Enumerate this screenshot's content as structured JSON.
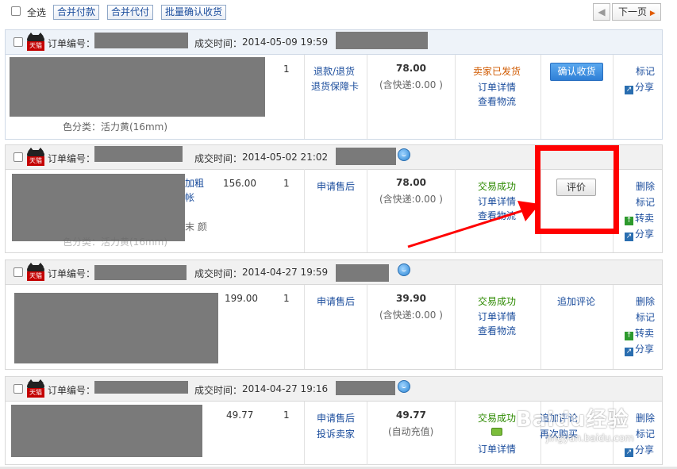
{
  "toolbar": {
    "select_all": "全选",
    "merge_pay": "合并付款",
    "merge_proxy_pay": "合并代付",
    "batch_confirm": "批量确认收货",
    "next_page": "下一页"
  },
  "labels": {
    "order_no": "订单编号：",
    "deal_time_prefix": "成交时间：",
    "tmall": "天猫"
  },
  "orders": [
    {
      "time": "2014-05-09 19:59",
      "qty": "1",
      "unit_price": "",
      "actions": [
        "退款/退货",
        "退货保障卡"
      ],
      "total": "78.00",
      "shipping": "(含快递:0.00 )",
      "status": "卖家已发货",
      "status_links": [
        "订单详情",
        "查看物流"
      ],
      "op_button": "确认收货",
      "op_link": "",
      "side": [
        "标记",
        "分享"
      ],
      "sku": "色分类：活力黄(16mm)"
    },
    {
      "time": "2014-05-02 21:02",
      "qty": "1",
      "unit_price": "156.00",
      "actions": [
        "申请售后"
      ],
      "total": "78.00",
      "shipping": "(含快递:0.00 )",
      "status": "交易成功",
      "status_links": [
        "订单详情",
        "查看物流"
      ],
      "op_button": "评价",
      "op_link": "",
      "side": [
        "删除",
        "标记",
        "转卖",
        "分享"
      ],
      "title_frags": [
        "加粗",
        "帐",
        "末 颜"
      ],
      "sku": "色分类：活力黄(16mm)"
    },
    {
      "time": "2014-04-27 19:59",
      "qty": "1",
      "unit_price": "199.00",
      "actions": [
        "申请售后"
      ],
      "total": "39.90",
      "shipping": "(含快递:0.00 )",
      "status": "交易成功",
      "status_links": [
        "订单详情",
        "查看物流"
      ],
      "op_button": "",
      "op_link": "追加评论",
      "side": [
        "删除",
        "标记",
        "转卖",
        "分享"
      ]
    },
    {
      "time": "2014-04-27 19:16",
      "qty": "1",
      "unit_price": "49.77",
      "actions": [
        "申请售后",
        "投诉卖家"
      ],
      "total": "49.77",
      "shipping": "(自动充值)",
      "status": "交易成功",
      "status_links": [
        "订单详情"
      ],
      "op_button": "",
      "op_link": "追加评论",
      "op_link2": "再次购买",
      "side": [
        "删除",
        "标记",
        "分享"
      ]
    }
  ],
  "watermark": {
    "brand": "Baidu经验",
    "url": "jingyan.baidu.com"
  },
  "colors": {
    "link": "#1a4c9c",
    "status_shipped": "#d05a00",
    "status_success": "#2d8a00",
    "highlight": "#ff0000",
    "confirm_btn": "#3d8fe0"
  }
}
